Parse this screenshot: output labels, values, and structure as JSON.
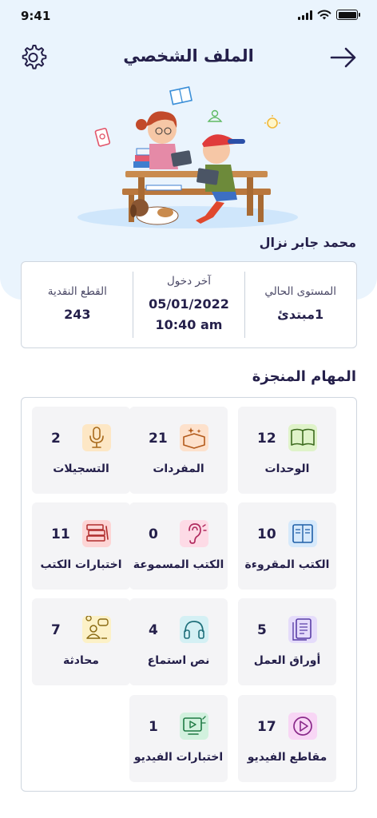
{
  "status": {
    "time": "9:41"
  },
  "header": {
    "title": "الملف الشخصي"
  },
  "user": {
    "name": "محمد جابر نزال"
  },
  "stats": [
    {
      "label": "المستوى الحالي",
      "value": "1مبتدئ"
    },
    {
      "label": "آخر دخول",
      "value": "05/01/2022\n10:40 am"
    },
    {
      "label": "القطع النقدية",
      "value": "243"
    }
  ],
  "tasks": {
    "title": "المهام المنجزة",
    "items": [
      {
        "label": "الوحدات",
        "count": "12",
        "icon": "open-book-icon",
        "color": "#dff3c9"
      },
      {
        "label": "المفردات",
        "count": "21",
        "icon": "book-stars-icon",
        "color": "#fde1cc"
      },
      {
        "label": "التسجيلات",
        "count": "2",
        "icon": "microphone-icon",
        "color": "#fde7c5"
      },
      {
        "label": "الكتب المقروءة",
        "count": "10",
        "icon": "reading-book-icon",
        "color": "#d6e9fb"
      },
      {
        "label": "الكتب المسموعة",
        "count": "0",
        "icon": "ear-icon",
        "color": "#fddbe6"
      },
      {
        "label": "اختبارات الكتب",
        "count": "11",
        "icon": "books-stack-icon",
        "color": "#fdd5d5"
      },
      {
        "label": "أوراق العمل",
        "count": "5",
        "icon": "worksheet-icon",
        "color": "#e5dcfb"
      },
      {
        "label": "نص استماع",
        "count": "4",
        "icon": "headphones-icon",
        "color": "#d4f0f4"
      },
      {
        "label": "محادثة",
        "count": "7",
        "icon": "chat-people-icon",
        "color": "#fcf1c7"
      },
      {
        "label": "مقاطع الفيديو",
        "count": "17",
        "icon": "play-circle-icon",
        "color": "#f8d6f5"
      },
      {
        "label": "اختبارات الفيديو",
        "count": "1",
        "icon": "video-test-icon",
        "color": "#d2f1de"
      }
    ]
  }
}
